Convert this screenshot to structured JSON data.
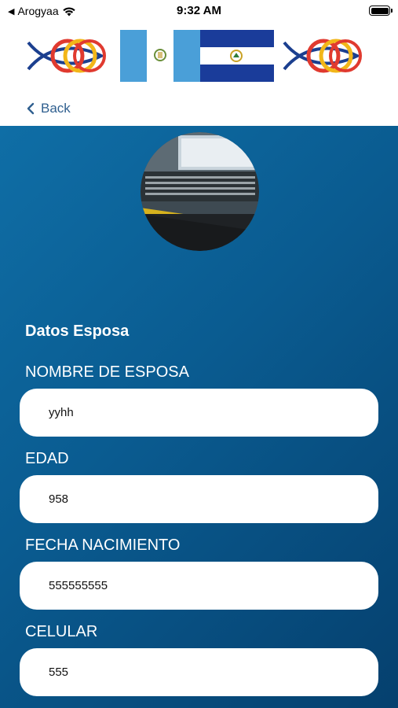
{
  "status_bar": {
    "carrier": "Arogyaa",
    "time": "9:32 AM"
  },
  "nav": {
    "back_label": "Back"
  },
  "colors": {
    "accent_blue": "#0b5d93",
    "back_link": "#2f5f8f",
    "field_bg": "#ffffff"
  },
  "icons": [
    "back-triangle-icon",
    "wifi-icon",
    "battery-icon",
    "chevron-left-icon"
  ],
  "form": {
    "section_title": "Datos Esposa",
    "fields": [
      {
        "label": "NOMBRE DE ESPOSA",
        "value": "yyhh"
      },
      {
        "label": "EDAD",
        "value": "958"
      },
      {
        "label": "FECHA NACIMIENTO",
        "value": "555555555"
      },
      {
        "label": "CELULAR",
        "value": "555"
      }
    ]
  }
}
